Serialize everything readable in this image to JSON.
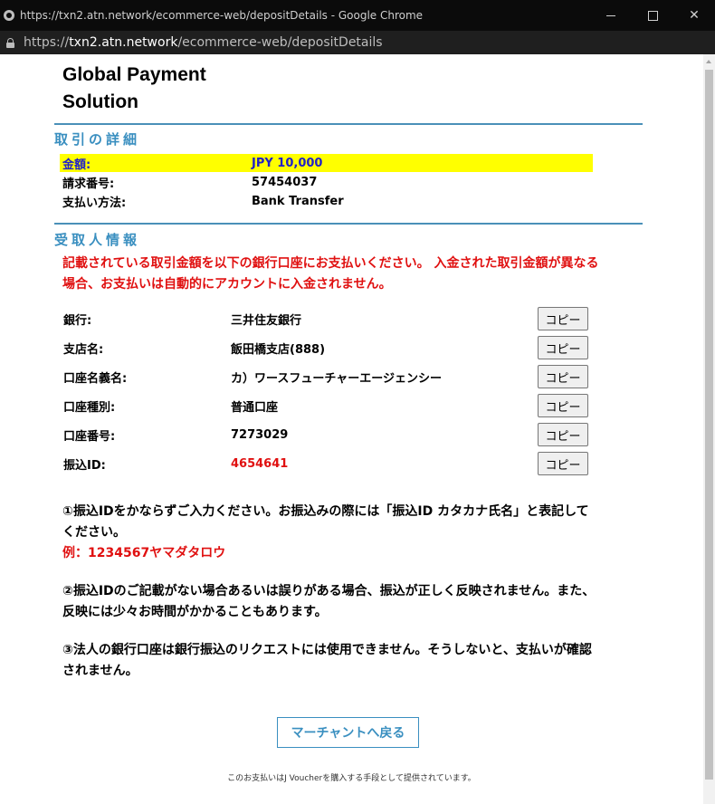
{
  "window": {
    "title": "https://txn2.atn.network/ecommerce-web/depositDetails - Google Chrome",
    "minimize_label": "—",
    "maximize_label": "☐",
    "close_label": "✕"
  },
  "address_bar": {
    "scheme": "https://",
    "host": "txn2.atn.network",
    "path": "/ecommerce-web/depositDetails"
  },
  "brand": {
    "line1": "Global Payment",
    "line2": "Solution"
  },
  "transaction": {
    "section_title": "取引の詳細",
    "rows": [
      {
        "label": "金額:",
        "value": "JPY 10,000",
        "highlight": true
      },
      {
        "label": "請求番号:",
        "value": "57454037"
      },
      {
        "label": "支払い方法:",
        "value": "Bank Transfer"
      }
    ]
  },
  "recipient": {
    "section_title": "受取人情報",
    "warning": "記載されている取引金額を以下の銀行口座にお支払いください。 入金された取引金額が異なる場合、お支払いは自動的にアカウントに入金されません。",
    "copy_label": "コピー",
    "rows": [
      {
        "label": "銀行:",
        "value": "三井住友銀行"
      },
      {
        "label": "支店名:",
        "value": "飯田橋支店(888)"
      },
      {
        "label": "口座名義名:",
        "value": "カ）ワースフューチャーエージェンシー"
      },
      {
        "label": "口座種別:",
        "value": "普通口座"
      },
      {
        "label": "口座番号:",
        "value": "7273029"
      },
      {
        "label": "振込ID:",
        "value": "4654641",
        "accent": "#e01010"
      }
    ]
  },
  "notes": {
    "n1": "①振込IDをかならずご入力ください。お振込みの際には「振込ID カタカナ氏名」と表記してください。",
    "n1_example": "例：1234567ヤマダタロウ",
    "n2": "②振込IDのご記載がない場合あるいは誤りがある場合、振込が正しく反映されません。また、反映には少々お時間がかかることもあります。",
    "n3": "③法人の銀行口座は銀行振込のリクエストには使用できません。そうしないと、支払いが確認されません。"
  },
  "back_button": "マーチャントへ戻る",
  "footer": "このお支払いはJ Voucherを購入する手段として提供されています。",
  "colors": {
    "accent": "#3a8fc0",
    "warning": "#e01010",
    "highlight": "#ffff00"
  }
}
